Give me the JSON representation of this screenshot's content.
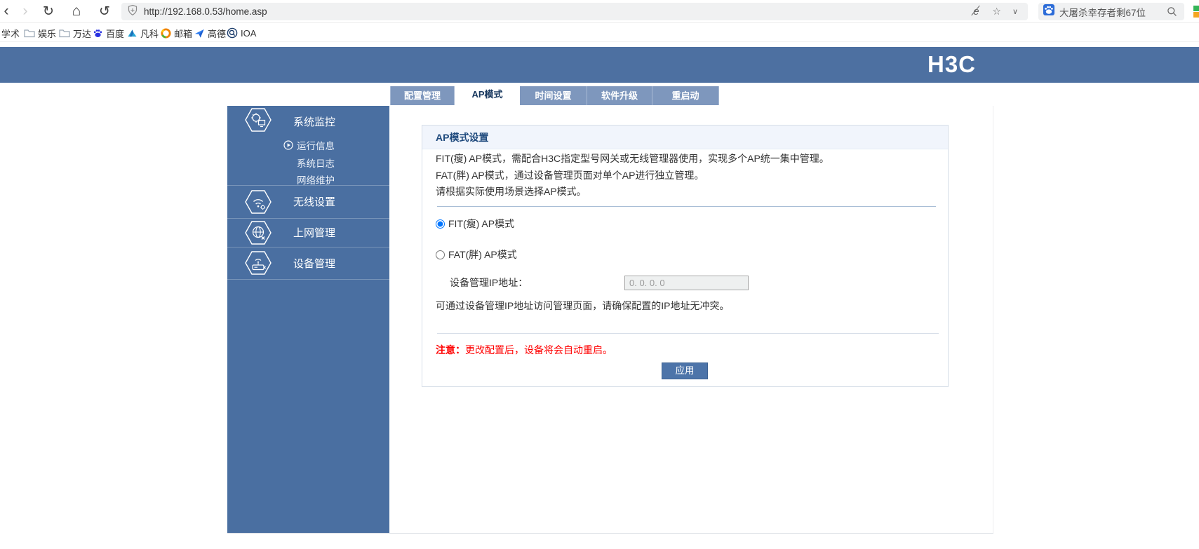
{
  "browser": {
    "url": "http://192.168.0.53/home.asp",
    "search": {
      "text": "大屠杀幸存者剩67位"
    },
    "bookmarks": [
      {
        "label": "学术"
      },
      {
        "label": "娱乐"
      },
      {
        "label": "万达"
      },
      {
        "label": "百度"
      },
      {
        "label": "凡科"
      },
      {
        "label": "邮箱"
      },
      {
        "label": "高德"
      },
      {
        "label": "IOA"
      }
    ]
  },
  "site": {
    "logo": "H3C",
    "tabs": [
      {
        "label": "配置管理",
        "active": false
      },
      {
        "label": "AP模式",
        "active": true
      },
      {
        "label": "时间设置",
        "active": false
      },
      {
        "label": "软件升级",
        "active": false
      },
      {
        "label": "重启动",
        "active": false
      }
    ],
    "sidebar": [
      {
        "label": "系统监控",
        "children": [
          {
            "label": "运行信息",
            "active": true
          },
          {
            "label": "系统日志",
            "active": false
          },
          {
            "label": "网络维护",
            "active": false
          }
        ]
      },
      {
        "label": "无线设置"
      },
      {
        "label": "上网管理"
      },
      {
        "label": "设备管理"
      }
    ],
    "panel": {
      "title": "AP模式设置",
      "descriptions": [
        "FIT(瘦) AP模式，需配合H3C指定型号网关或无线管理器使用，实现多个AP统一集中管理。",
        "FAT(胖) AP模式，通过设备管理页面对单个AP进行独立管理。",
        "请根据实际使用场景选择AP模式。"
      ],
      "radio_fit": {
        "label": "FIT(瘦) AP模式",
        "selected": true
      },
      "radio_fat": {
        "label": "FAT(胖) AP模式",
        "selected": false
      },
      "ip_field": {
        "label": "设备管理IP地址：",
        "value": "0. 0. 0. 0",
        "disabled": true
      },
      "ip_note": "可通过设备管理IP地址访问管理页面，请确保配置的IP地址无冲突。",
      "warning": {
        "prefix": "注意：",
        "text": "更改配置后，设备将会自动重启。"
      },
      "apply_label": "应用"
    }
  },
  "colors": {
    "header_blue": "#4d70a1",
    "sidebar_blue": "#4a6fa1",
    "tab_inactive_blue": "#7e97bd",
    "panel_header_bg": "#f1f5fc",
    "warning_red": "#ff0000",
    "button_blue": "#4d74a9"
  }
}
